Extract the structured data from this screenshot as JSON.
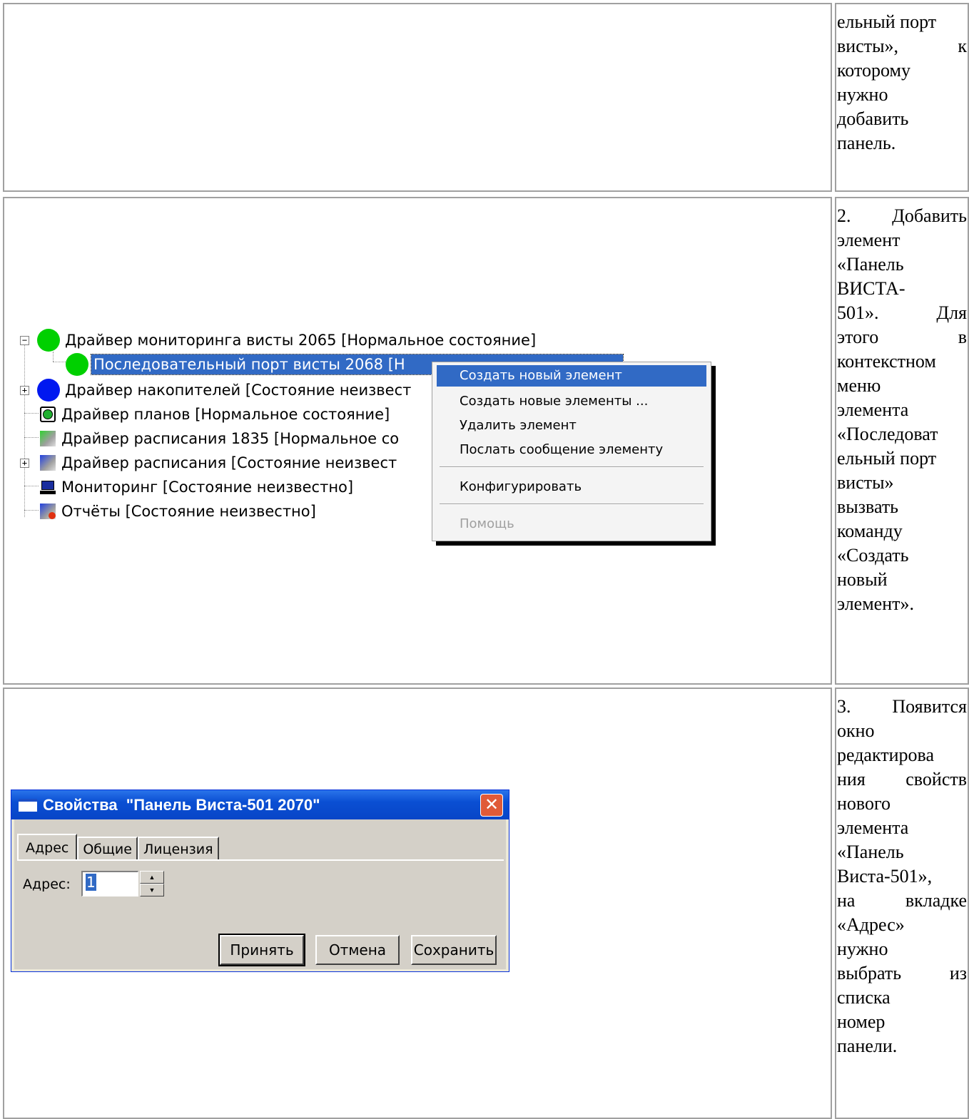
{
  "instructions": {
    "step1_tail": [
      "ельный порт",
      "висты»,",
      "к",
      "которому",
      "нужно",
      "добавить",
      "панель."
    ],
    "step2": [
      "2.",
      "Добавить",
      "элемент",
      "«Панель",
      "ВИСТА-",
      "501».",
      "Для",
      "этого",
      "в",
      "контекстном",
      "меню",
      "элемента",
      "«Последоват",
      "ельный порт",
      "висты»",
      "вызвать",
      "команду",
      "«Создать",
      "новый",
      "элемент»."
    ],
    "step3": [
      "3.",
      "Появится",
      "окно",
      "редактирова",
      "ния",
      "свойств",
      "нового",
      "элемента",
      "«Панель",
      "Виста-501»,",
      "на",
      "вкладке",
      "«Адрес»",
      "нужно",
      "выбрать",
      "из",
      "списка",
      "номер",
      "панели."
    ]
  },
  "tree": {
    "items": [
      "Драйвер мониторинга висты 2065 [Нормальное состояние]",
      "Последовательный порт висты 2068 [Н",
      "Драйвер накопителей [Состояние неизвест",
      "Драйвер планов [Нормальное состояние]",
      "Драйвер расписания 1835 [Нормальное со",
      "Драйвер расписания [Состояние неизвест",
      "Мониторинг [Состояние неизвестно]",
      "Отчёты [Состояние неизвестно]"
    ],
    "colors": {
      "green": "#00d000",
      "blue": "#0018f0",
      "selection": "#316ac5"
    }
  },
  "context_menu": {
    "items": [
      "Создать новый элемент",
      "Создать новые элементы ...",
      "Удалить элемент",
      "Послать сообщение элементу",
      "Конфигурировать",
      "Помощь"
    ],
    "highlighted": "Создать новый элемент",
    "disabled": "Помощь"
  },
  "dialog": {
    "title": "Свойства  \"Панель Виста-501 2070\"",
    "tabs": [
      "Адрес",
      "Общие",
      "Лицензия"
    ],
    "active_tab": "Адрес",
    "address_label": "Адрес:",
    "address_value": "1",
    "buttons": {
      "accept": "Принять",
      "cancel": "Отмена",
      "save": "Сохранить"
    }
  }
}
